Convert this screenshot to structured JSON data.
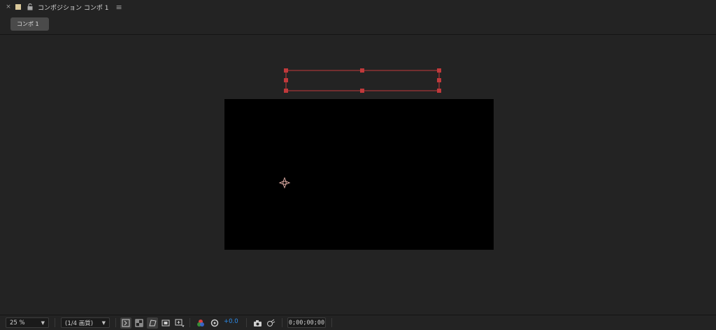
{
  "panel": {
    "close_glyph": "×",
    "title": "コンポジション コンポ 1",
    "menu_glyph": "≡",
    "label_color": "#d9c89a"
  },
  "tab": {
    "label": "コンポ 1"
  },
  "viewer": {
    "canvas_color": "#000000",
    "bbox_color": "#c0393b"
  },
  "toolbar": {
    "zoom": "25 %",
    "resolution": "(1/4 画質)",
    "exposure": "+0.0",
    "timecode": "0;00;00;00",
    "accent_color": "#2d8ceb",
    "icons": [
      "fast-previews-icon",
      "transparency-grid-icon",
      "mask-path-visibility-icon",
      "region-of-interest-icon",
      "choose-grid-guides-icon",
      "show-channel-icon",
      "reset-exposure-icon",
      "snapshot-icon",
      "show-snapshot-icon"
    ]
  }
}
